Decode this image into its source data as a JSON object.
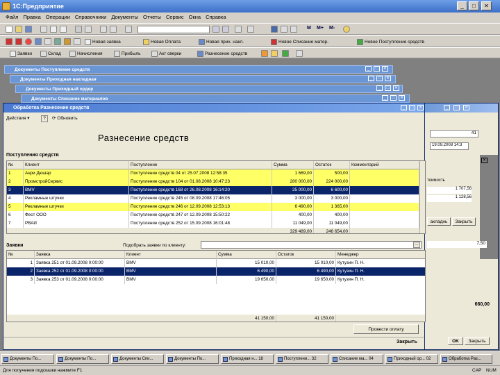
{
  "app": {
    "title": "1С:Предприятие"
  },
  "menu": [
    "Файл",
    "Правка",
    "Операции",
    "Справочники",
    "Документы",
    "Отчеты",
    "Сервис",
    "Окна",
    "Справка"
  ],
  "toolbar2": {
    "new_request": "Новая заявка",
    "new_payment": "Новая Оплата",
    "new_receipt": "Новая прих. накл.",
    "new_writeoff": "Новое Списание матер.",
    "new_income": "Новое Поступление средств"
  },
  "toolbar3": {
    "requests": "Заявки",
    "warehouse": "Склад",
    "accruals": "Начисления",
    "profit": "Прибыль",
    "reconciliation": "Акт сверки",
    "allocation": "Разнесение средств"
  },
  "mdi_windows": [
    "Документы Поступление средств",
    "Документы Приходная накладная",
    "Документы Приходный ордер",
    "Документы Списание материалов"
  ],
  "dialog": {
    "title": "Обработка  Разнесение средств",
    "actions_label": "Действия",
    "help_label": "?",
    "refresh_label": "Обновить",
    "heading": "Разнесение средств",
    "receipts_section": "Поступления средств",
    "requests_section": "Заявки",
    "filter_label": "Подобрать заявки по клиенту:",
    "pay_button": "Провести оплату",
    "close_button": "Закрыть"
  },
  "receipts": {
    "columns": [
      "№",
      "Клиент",
      "Поступление",
      "Сумма",
      "Остаток",
      "Комментарий"
    ],
    "rows": [
      {
        "n": "1",
        "client": "Анри Дюшар",
        "doc": "Поступление средств 04 от 25.07.2008 12:58:35",
        "sum": "1 669,00",
        "rest": "500,00",
        "style": "yellow"
      },
      {
        "n": "2",
        "client": "ПромстройСервис",
        "doc": "Поступление средств 104 от 01.08.2008 10:47:23",
        "sum": "280 000,00",
        "rest": "224 000,00",
        "style": "yellow"
      },
      {
        "n": "3",
        "client": "BMV",
        "doc": "Поступление средств 168 от 26.08.2008 16:14:20",
        "sum": "25 000,00",
        "rest": "6 600,00",
        "style": "selected"
      },
      {
        "n": "4",
        "client": "Рекламные штучки",
        "doc": "Поступление средств 245 от 08.09.2008 17:46:05",
        "sum": "3 000,00",
        "rest": "3 000,00",
        "style": "white"
      },
      {
        "n": "5",
        "client": "Рекламные штучки",
        "doc": "Поступление средств 246 от 12.09.2008 12:53:13",
        "sum": "6 490,00",
        "rest": "1 365,00",
        "style": "yellow"
      },
      {
        "n": "6",
        "client": "Фест ООО",
        "doc": "Поступление средств 247 от 12.09.2008 15:50:22",
        "sum": "400,00",
        "rest": "400,00",
        "style": "white"
      },
      {
        "n": "7",
        "client": "РВАИ",
        "doc": "Поступление средств 252 от 15.09.2008 16:01:48",
        "sum": "11 049,00",
        "rest": "11 049,00",
        "style": "white"
      }
    ],
    "total_sum": "329 489,00",
    "total_rest": "246 654,00"
  },
  "requests": {
    "columns": [
      "№",
      "Заявка",
      "Клиент",
      "Сумма",
      "Остаток",
      "Менеджер"
    ],
    "rows": [
      {
        "n": "1",
        "doc": "Заявка 251 от 01.09.2008 0:00:00",
        "client": "BMV",
        "sum": "15 010,00",
        "rest": "15 010,00",
        "manager": "Кутузин П. Н.",
        "style": "white"
      },
      {
        "n": "2",
        "doc": "Заявка 252 от 01.09.2008 0:00:00",
        "client": "BMV",
        "sum": "6 490,00",
        "rest": "6 490,00",
        "manager": "Кутузин П. Н.",
        "style": "selected"
      },
      {
        "n": "3",
        "doc": "Заявка 253 от 01.09.2008 0:00:00",
        "client": "BMV",
        "sum": "19 650,00",
        "rest": "19 650,00",
        "manager": "Кутузин П. Н.",
        "style": "white"
      }
    ],
    "total_sum": "41 150,00",
    "total_rest": "41 150,00"
  },
  "right_panel": {
    "num": "41",
    "date": "19.09.2008 14:3",
    "amount_label": "тоимость",
    "v1": "1 707,56",
    "v2": "1 128,56",
    "rows_btn": "акладнь",
    "close_btn": "Закрыть",
    "rate": "7,50",
    "total": "660,00",
    "ok": "OK",
    "close2": "Закрыть"
  },
  "taskbar": [
    "Документы По...",
    "Документы По...",
    "Документы Спи...",
    "Документы По...",
    "Приходная н... 18",
    "Поступлени... 32",
    "Списание ма... 04",
    "Приходный ор... 02",
    "Обработка  Раз..."
  ],
  "status": {
    "hint": "Для получения подсказки нажмите F1",
    "cap": "CAP",
    "num": "NUM"
  }
}
